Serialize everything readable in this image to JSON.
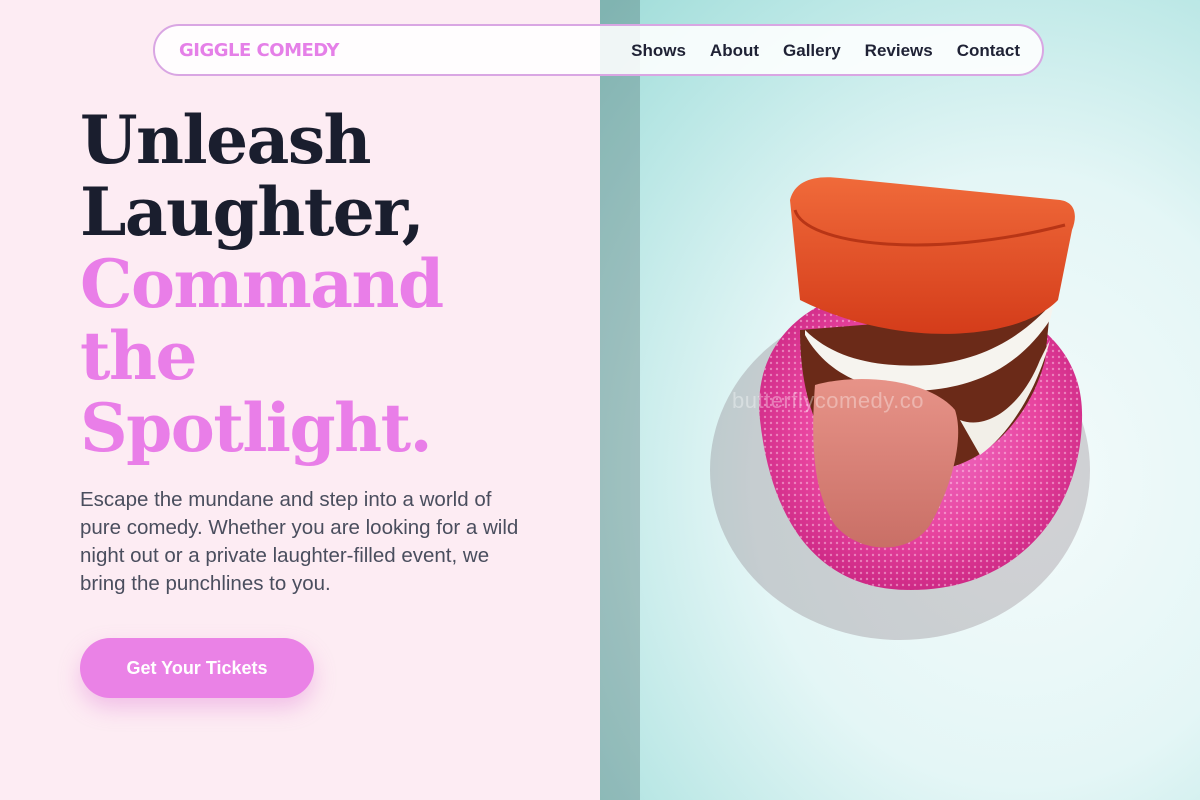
{
  "brand": {
    "name": "GIGGLE COMEDY"
  },
  "nav": {
    "items": [
      {
        "label": "Shows"
      },
      {
        "label": "About"
      },
      {
        "label": "Gallery"
      },
      {
        "label": "Reviews"
      },
      {
        "label": "Contact"
      }
    ]
  },
  "hero": {
    "headline_dark": [
      "Unleash",
      "Laughter,"
    ],
    "headline_pink": [
      "Command",
      "the",
      "Spotlight."
    ],
    "description": "Escape the mundane and step into a world of pure comedy. Whether you are looking for a wild night out or a private laughter-filled event, we bring the punchlines to you.",
    "cta_label": "Get Your Tickets"
  },
  "image": {
    "subject": "wind-up chattering teeth toy with tongue on pink sponge",
    "watermark": "butterflycomedy.co"
  },
  "colors": {
    "accent_pink": "#e97ee8",
    "dark_text": "#1a1e2e",
    "left_background": "#fdecf3",
    "nav_border": "#d9a6e3"
  }
}
